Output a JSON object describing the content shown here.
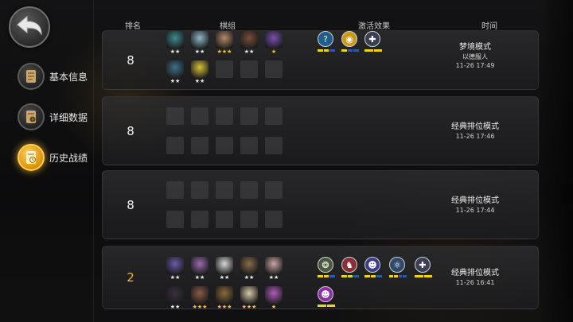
{
  "sidebar": {
    "items": [
      {
        "label": "基本信息",
        "icon": "scroll-icon",
        "active": false
      },
      {
        "label": "详细数据",
        "icon": "scroll-info-icon",
        "active": false
      },
      {
        "label": "历史战绩",
        "icon": "history-scroll-icon",
        "active": true
      }
    ]
  },
  "header": {
    "rank": "排名",
    "lineup": "棋组",
    "synergy": "激活效果",
    "time": "时间"
  },
  "colors": {
    "gold": "#f0b52a",
    "bar_on": "#f1d50a",
    "bar_off": "#2d5aa6"
  },
  "rows": [
    {
      "rank": "8",
      "mode": "梦境模式",
      "sub": "以德服人",
      "date": "11-26 17:49",
      "pieces": [
        {
          "color": "#3f8a8f",
          "stars": "★★",
          "gold": false
        },
        {
          "color": "#8fb8c9",
          "stars": "★★",
          "gold": false
        },
        {
          "color": "#b48a6a",
          "stars": "★★★",
          "gold": true
        },
        {
          "color": "#7a4e3b",
          "stars": "★★",
          "gold": false
        },
        {
          "color": "#7a4fb0",
          "stars": "★",
          "gold": true
        },
        {
          "color": "#3e6f8a",
          "stars": "★★",
          "gold": false
        },
        {
          "color": "#d9c23a",
          "stars": "★★",
          "gold": false
        }
      ],
      "synergies": [
        {
          "symbol": "?",
          "bg": "#1f5d8c",
          "bar": [
            1,
            1,
            0
          ]
        },
        {
          "symbol": "◉",
          "bg": "#c89a18",
          "bar": [
            1,
            0,
            0
          ]
        },
        {
          "symbol": "✚",
          "bg": "#3b3f56",
          "bar": [
            1,
            1
          ]
        }
      ]
    },
    {
      "rank": "8",
      "mode": "经典排位模式",
      "date": "11-26 17:46",
      "pieces": [],
      "synergies": []
    },
    {
      "rank": "8",
      "mode": "经典排位模式",
      "date": "11-26 17:44",
      "pieces": [],
      "synergies": []
    },
    {
      "rank": "2",
      "mode": "经典排位模式",
      "date": "11-26 16:41",
      "pieces": [
        {
          "color": "#6a5aa8",
          "stars": "★★",
          "gold": false
        },
        {
          "color": "#9a6bb0",
          "stars": "★★",
          "gold": false
        },
        {
          "color": "#d8d8d8",
          "stars": "★★",
          "gold": false
        },
        {
          "color": "#8a6b4a",
          "stars": "★★",
          "gold": false
        },
        {
          "color": "#caa4a4",
          "stars": "★★",
          "gold": false
        },
        {
          "color": "#3a2f3f",
          "stars": "★★",
          "gold": false
        },
        {
          "color": "#8a5a48",
          "stars": "★★★",
          "gold": true
        },
        {
          "color": "#8a6b3a",
          "stars": "★★★",
          "gold": true
        },
        {
          "color": "#d8c9a8",
          "stars": "★★★",
          "gold": true
        },
        {
          "color": "#b05ab8",
          "stars": "★",
          "gold": true
        },
        {
          "color": "#5a6a7a",
          "stars": "★★",
          "gold": false
        }
      ],
      "synergies": [
        {
          "symbol": "❂",
          "bg": "#4a5a3a",
          "bar": [
            1,
            1,
            0
          ]
        },
        {
          "symbol": "♞",
          "bg": "#8a2f3a",
          "bar": [
            1,
            1,
            0
          ]
        },
        {
          "symbol": "☻",
          "bg": "#3a3f8a",
          "bar": [
            1,
            1,
            0
          ]
        },
        {
          "symbol": "⚛",
          "bg": "#2f4a6a",
          "bar": [
            1,
            1,
            0,
            0
          ]
        },
        {
          "symbol": "✚",
          "bg": "#3b3f56",
          "bar": [
            1,
            1
          ]
        },
        {
          "symbol": "☻",
          "bg": "#8a2fa8",
          "bar": [
            1,
            1
          ]
        }
      ]
    }
  ]
}
